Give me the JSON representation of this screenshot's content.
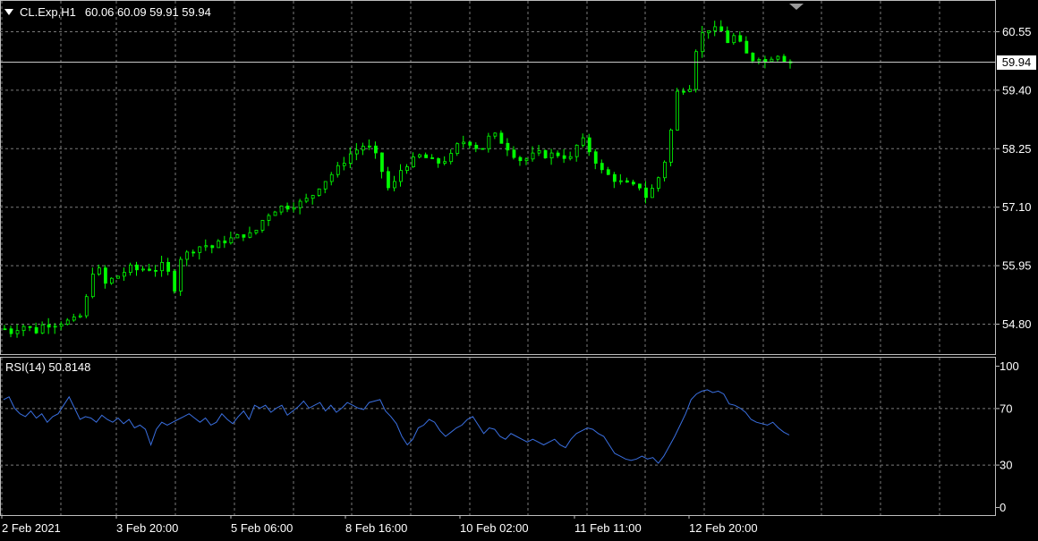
{
  "window": {
    "symbol_label": "CL.Exp,H1",
    "ohlc_values": "60.06 60.09 59.91 59.94",
    "current_price_tag": "59.94"
  },
  "price_axis": {
    "labels": [
      "60.55",
      "59.40",
      "58.25",
      "57.10",
      "55.95",
      "54.80"
    ]
  },
  "indicator": {
    "title": "RSI(14) 50.8148",
    "axis_labels": [
      "100",
      "70",
      "30",
      "0"
    ],
    "color": "#3a6fe0"
  },
  "time_axis": {
    "labels": [
      "2 Feb 2021",
      "3 Feb 20:00",
      "5 Feb 06:00",
      "8 Feb 16:00",
      "10 Feb 02:00",
      "11 Feb 11:00",
      "12 Feb 20:00"
    ]
  },
  "colors": {
    "background": "#000000",
    "candles": "#00ff00",
    "grid": "#7a7a7a",
    "rsi_line": "#3a6fe0",
    "text": "#ffffff"
  },
  "chart_data": [
    {
      "type": "candlestick",
      "title": "CL.Exp,H1",
      "x_labels": [
        "2 Feb 2021",
        "3 Feb 20:00",
        "5 Feb 06:00",
        "8 Feb 16:00",
        "10 Feb 02:00",
        "11 Feb 11:00",
        "12 Feb 20:00"
      ],
      "ylim": [
        54.2,
        60.9
      ],
      "y_ticks": [
        54.8,
        55.95,
        57.1,
        58.25,
        59.4,
        60.55
      ],
      "last_ohlc": {
        "open": 60.06,
        "high": 60.09,
        "low": 59.91,
        "close": 59.94
      },
      "grid": true,
      "close_path": [
        [
          0,
          54.7
        ],
        [
          5,
          54.62
        ],
        [
          10,
          54.78
        ],
        [
          15,
          54.72
        ],
        [
          20,
          54.65
        ],
        [
          25,
          54.8
        ],
        [
          30,
          54.78
        ],
        [
          35,
          54.82
        ],
        [
          40,
          54.85
        ],
        [
          45,
          54.88
        ],
        [
          48,
          54.95
        ],
        [
          52,
          55.3
        ],
        [
          55,
          55.7
        ],
        [
          57,
          55.95
        ],
        [
          60,
          55.85
        ],
        [
          63,
          55.55
        ],
        [
          66,
          55.65
        ],
        [
          70,
          55.7
        ],
        [
          75,
          55.8
        ],
        [
          80,
          55.9
        ],
        [
          85,
          55.85
        ],
        [
          90,
          55.9
        ],
        [
          95,
          55.85
        ],
        [
          100,
          55.95
        ],
        [
          104,
          55.8
        ],
        [
          107,
          55.4
        ],
        [
          110,
          55.7
        ],
        [
          112,
          56.1
        ],
        [
          117,
          56.2
        ],
        [
          122,
          56.3
        ],
        [
          127,
          56.35
        ],
        [
          132,
          56.3
        ],
        [
          137,
          56.4
        ],
        [
          142,
          56.45
        ],
        [
          147,
          56.5
        ],
        [
          152,
          56.55
        ],
        [
          157,
          56.55
        ],
        [
          162,
          56.7
        ],
        [
          165,
          56.9
        ],
        [
          170,
          57.0
        ],
        [
          175,
          57.1
        ],
        [
          180,
          57.1
        ],
        [
          185,
          57.15
        ],
        [
          190,
          57.2
        ],
        [
          195,
          57.3
        ],
        [
          200,
          57.5
        ],
        [
          205,
          57.65
        ],
        [
          210,
          57.8
        ],
        [
          215,
          57.95
        ],
        [
          218,
          58.1
        ],
        [
          223,
          58.2
        ],
        [
          228,
          58.3
        ],
        [
          233,
          58.25
        ],
        [
          236,
          58.1
        ],
        [
          240,
          57.8
        ],
        [
          243,
          57.55
        ],
        [
          246,
          57.3
        ],
        [
          249,
          57.7
        ],
        [
          254,
          57.9
        ],
        [
          259,
          58.0
        ],
        [
          264,
          58.1
        ],
        [
          269,
          58.05
        ],
        [
          274,
          57.95
        ],
        [
          279,
          58.0
        ],
        [
          284,
          58.1
        ],
        [
          289,
          58.35
        ],
        [
          294,
          58.4
        ],
        [
          299,
          58.3
        ],
        [
          303,
          58.2
        ],
        [
          307,
          58.45
        ],
        [
          312,
          58.5
        ],
        [
          317,
          58.35
        ],
        [
          322,
          58.2
        ],
        [
          326,
          58.05
        ],
        [
          330,
          58.0
        ],
        [
          335,
          58.1
        ],
        [
          340,
          58.15
        ],
        [
          345,
          58.1
        ],
        [
          350,
          58.15
        ],
        [
          355,
          58.1
        ],
        [
          360,
          58.05
        ],
        [
          364,
          58.3
        ],
        [
          368,
          58.4
        ],
        [
          372,
          58.2
        ],
        [
          376,
          58.0
        ],
        [
          380,
          57.8
        ],
        [
          385,
          57.7
        ],
        [
          390,
          57.6
        ],
        [
          395,
          57.55
        ],
        [
          400,
          57.5
        ],
        [
          404,
          57.5
        ],
        [
          408,
          57.3
        ],
        [
          411,
          57.4
        ],
        [
          414,
          57.55
        ],
        [
          418,
          57.8
        ],
        [
          421,
          58.1
        ],
        [
          424,
          58.6
        ],
        [
          426,
          59.1
        ],
        [
          428,
          59.35
        ],
        [
          431,
          59.45
        ],
        [
          435,
          59.35
        ],
        [
          438,
          59.7
        ],
        [
          440,
          60.2
        ],
        [
          444,
          60.5
        ],
        [
          448,
          60.6
        ],
        [
          452,
          60.58
        ],
        [
          456,
          60.55
        ],
        [
          460,
          60.35
        ],
        [
          464,
          60.45
        ],
        [
          468,
          60.3
        ],
        [
          472,
          60.1
        ],
        [
          476,
          60.0
        ],
        [
          480,
          60.05
        ],
        [
          484,
          59.95
        ],
        [
          488,
          60.05
        ],
        [
          492,
          60.1
        ],
        [
          496,
          60.0
        ],
        [
          500,
          59.94
        ]
      ]
    },
    {
      "type": "line",
      "title": "RSI(14) 50.8148",
      "ylim": [
        0,
        100
      ],
      "y_ticks": [
        0,
        30,
        70,
        100
      ],
      "last_value": 50.8148,
      "grid": true,
      "series": [
        {
          "name": "RSI(14)",
          "points": [
            [
              0,
              76
            ],
            [
              4,
              78
            ],
            [
              8,
              70
            ],
            [
              12,
              66
            ],
            [
              16,
              64
            ],
            [
              20,
              68
            ],
            [
              24,
              63
            ],
            [
              28,
              66
            ],
            [
              32,
              60
            ],
            [
              36,
              64
            ],
            [
              40,
              66
            ],
            [
              44,
              72
            ],
            [
              48,
              78
            ],
            [
              52,
              70
            ],
            [
              56,
              62
            ],
            [
              60,
              64
            ],
            [
              64,
              63
            ],
            [
              68,
              60
            ],
            [
              72,
              65
            ],
            [
              76,
              62
            ],
            [
              80,
              60
            ],
            [
              84,
              63
            ],
            [
              88,
              59
            ],
            [
              92,
              62
            ],
            [
              96,
              56
            ],
            [
              100,
              58
            ],
            [
              104,
              55
            ],
            [
              108,
              44
            ],
            [
              112,
              55
            ],
            [
              116,
              60
            ],
            [
              120,
              58
            ],
            [
              124,
              60
            ],
            [
              128,
              62
            ],
            [
              132,
              64
            ],
            [
              136,
              66
            ],
            [
              140,
              63
            ],
            [
              144,
              60
            ],
            [
              148,
              63
            ],
            [
              152,
              58
            ],
            [
              156,
              60
            ],
            [
              160,
              66
            ],
            [
              164,
              62
            ],
            [
              168,
              59
            ],
            [
              172,
              64
            ],
            [
              176,
              68
            ],
            [
              180,
              62
            ],
            [
              184,
              72
            ],
            [
              188,
              70
            ],
            [
              192,
              72
            ],
            [
              196,
              67
            ],
            [
              200,
              70
            ],
            [
              204,
              72
            ],
            [
              208,
              65
            ],
            [
              212,
              68
            ],
            [
              216,
              71
            ],
            [
              220,
              75
            ],
            [
              224,
              70
            ],
            [
              228,
              72
            ],
            [
              232,
              74
            ],
            [
              236,
              68
            ],
            [
              240,
              72
            ],
            [
              244,
              67
            ],
            [
              248,
              70
            ],
            [
              252,
              74
            ],
            [
              256,
              72
            ],
            [
              260,
              70
            ],
            [
              264,
              69
            ],
            [
              268,
              74
            ],
            [
              272,
              75
            ],
            [
              276,
              76
            ],
            [
              280,
              68
            ],
            [
              284,
              64
            ],
            [
              288,
              59
            ],
            [
              292,
              50
            ],
            [
              296,
              44
            ],
            [
              300,
              48
            ],
            [
              304,
              56
            ],
            [
              308,
              58
            ],
            [
              312,
              62
            ],
            [
              316,
              60
            ],
            [
              320,
              54
            ],
            [
              324,
              50
            ],
            [
              328,
              53
            ],
            [
              332,
              56
            ],
            [
              336,
              58
            ],
            [
              340,
              62
            ],
            [
              344,
              64
            ],
            [
              348,
              58
            ],
            [
              352,
              52
            ],
            [
              356,
              56
            ],
            [
              360,
              55
            ],
            [
              364,
              50
            ],
            [
              368,
              48
            ],
            [
              372,
              52
            ],
            [
              376,
              50
            ],
            [
              380,
              48
            ],
            [
              384,
              46
            ],
            [
              388,
              48
            ],
            [
              392,
              46
            ],
            [
              396,
              44
            ],
            [
              400,
              46
            ],
            [
              404,
              48
            ],
            [
              408,
              44
            ],
            [
              412,
              42
            ],
            [
              416,
              48
            ],
            [
              420,
              52
            ],
            [
              424,
              54
            ],
            [
              428,
              56
            ],
            [
              432,
              55
            ],
            [
              436,
              52
            ],
            [
              440,
              50
            ],
            [
              444,
              44
            ],
            [
              448,
              38
            ],
            [
              452,
              36
            ],
            [
              456,
              34
            ],
            [
              460,
              33
            ],
            [
              464,
              34
            ],
            [
              468,
              36
            ],
            [
              472,
              34
            ],
            [
              476,
              35
            ],
            [
              480,
              31
            ],
            [
              484,
              36
            ],
            [
              488,
              43
            ],
            [
              492,
              50
            ],
            [
              496,
              58
            ],
            [
              500,
              66
            ],
            [
              504,
              76
            ],
            [
              508,
              80
            ],
            [
              512,
              82
            ],
            [
              516,
              83
            ],
            [
              520,
              81
            ],
            [
              524,
              82
            ],
            [
              528,
              80
            ],
            [
              532,
              73
            ],
            [
              536,
              72
            ],
            [
              540,
              70
            ],
            [
              544,
              67
            ],
            [
              548,
              62
            ],
            [
              552,
              60
            ],
            [
              556,
              59
            ],
            [
              560,
              58
            ],
            [
              564,
              60
            ],
            [
              568,
              56
            ],
            [
              572,
              53
            ],
            [
              576,
              51
            ]
          ]
        }
      ]
    }
  ]
}
